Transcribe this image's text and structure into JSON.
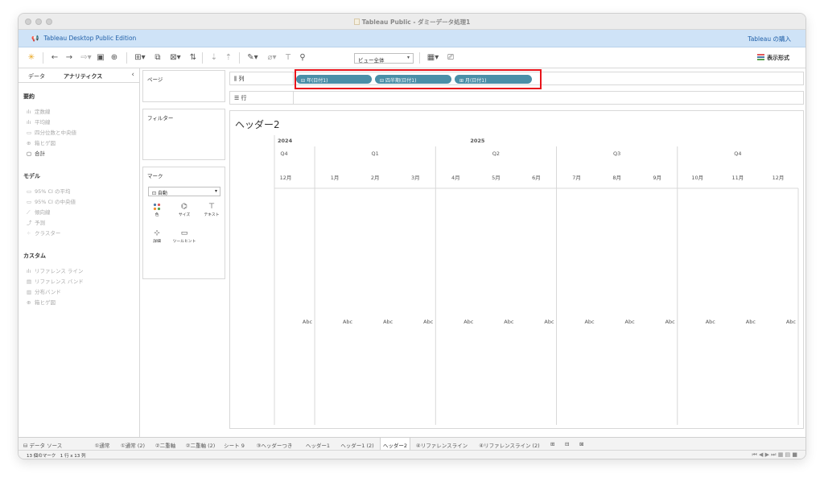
{
  "window": {
    "title": "Tableau Public - ダミーデータ処理1"
  },
  "promo": {
    "edition": "Tableau Desktop Public Edition",
    "buy": "Tableau の購入"
  },
  "toolbar": {
    "view_select": "ビュー全体",
    "show_me": "表示形式"
  },
  "left_pane": {
    "tabs": [
      "データ",
      "アナリティクス"
    ],
    "sections": [
      {
        "title": "要約",
        "items": [
          {
            "icon": "constant-line-icon",
            "glyph": "ılı",
            "label": "定数線",
            "enabled": false
          },
          {
            "icon": "average-line-icon",
            "glyph": "ılı",
            "label": "平均線",
            "enabled": false
          },
          {
            "icon": "median-quartiles-icon",
            "glyph": "▭",
            "label": "四分位数と中央値",
            "enabled": false
          },
          {
            "icon": "box-plot-icon",
            "glyph": "⊕",
            "label": "箱ヒゲ図",
            "enabled": false
          },
          {
            "icon": "totals-icon",
            "glyph": "▢",
            "label": "合計",
            "enabled": true
          }
        ]
      },
      {
        "title": "モデル",
        "items": [
          {
            "icon": "ci-average-icon",
            "glyph": "▭",
            "label": "95% CI の平均",
            "enabled": false
          },
          {
            "icon": "ci-median-icon",
            "glyph": "▭",
            "label": "95% CI の中央値",
            "enabled": false
          },
          {
            "icon": "trend-line-icon",
            "glyph": "⟋",
            "label": "傾向線",
            "enabled": false
          },
          {
            "icon": "forecast-icon",
            "glyph": "⤴",
            "label": "予測",
            "enabled": false
          },
          {
            "icon": "cluster-icon",
            "glyph": "⁘",
            "label": "クラスター",
            "enabled": false
          }
        ]
      },
      {
        "title": "カスタム",
        "items": [
          {
            "icon": "reference-line-icon",
            "glyph": "ılı",
            "label": "リファレンス ライン",
            "enabled": false
          },
          {
            "icon": "reference-band-icon",
            "glyph": "▤",
            "label": "リファレンス バンド",
            "enabled": false
          },
          {
            "icon": "distribution-band-icon",
            "glyph": "▥",
            "label": "分布バンド",
            "enabled": false
          },
          {
            "icon": "box-plot-icon",
            "glyph": "⊕",
            "label": "箱ヒゲ図",
            "enabled": false
          }
        ]
      }
    ]
  },
  "cards": {
    "pages": "ページ",
    "filters": "フィルター",
    "marks": "マーク",
    "mark_type": "自動",
    "mark_buttons": [
      "色",
      "サイズ",
      "テキスト",
      "詳細",
      "ツールヒント"
    ]
  },
  "shelves": {
    "columns_label": "列",
    "rows_label": "行",
    "column_pills": [
      "年(日付1)",
      "四半期(日付1)",
      "月(日付1)"
    ]
  },
  "viz": {
    "title": "ヘッダー2",
    "years": [
      "2024",
      "2025"
    ],
    "quarters": [
      "Q4",
      "Q1",
      "Q2",
      "Q3",
      "Q4"
    ],
    "months": [
      "12月",
      "1月",
      "2月",
      "3月",
      "4月",
      "5月",
      "6月",
      "7月",
      "8月",
      "9月",
      "10月",
      "11月",
      "12月"
    ],
    "cell_text": "Abc"
  },
  "sheet_tabs": {
    "datasource": "データ ソース",
    "tabs": [
      "①通常",
      "①通常 (2)",
      "②二重軸",
      "②二重軸 (2)",
      "シート 9",
      "③ヘッダーつき",
      "ヘッダー1",
      "ヘッダー1 (2)",
      "ヘッダー2",
      "④リファレンスライン",
      "④リファレンスライン (2)"
    ],
    "active": "ヘッダー2"
  },
  "status": {
    "text": "13 個のマーク　1 行 x 13 列"
  }
}
